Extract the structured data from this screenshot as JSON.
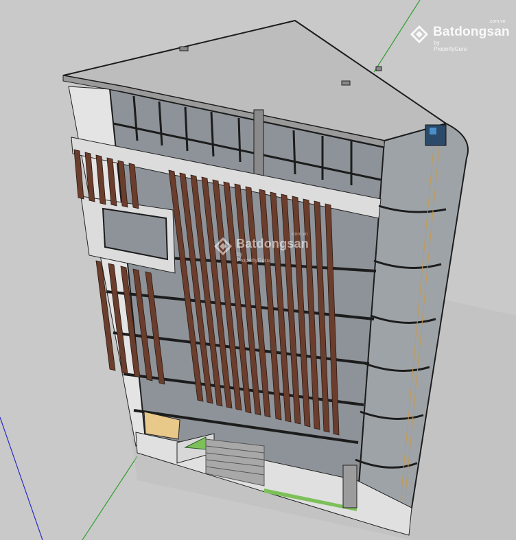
{
  "watermark": {
    "brand": "Batdongsan",
    "tld": ".com.vn",
    "byline": "by PropertyGuru"
  },
  "colors": {
    "ground": "#c9c9c9",
    "roof": "#bdbdbd",
    "glass": "#8e9399",
    "frame": "#1c1c1c",
    "slats": "#6b3d2c",
    "concrete": "#dcdcdc",
    "lawn": "#7dc05a",
    "wood_panel": "#e8c98a",
    "axis_green": "#2fa02f",
    "axis_blue": "#2a2ac8"
  }
}
